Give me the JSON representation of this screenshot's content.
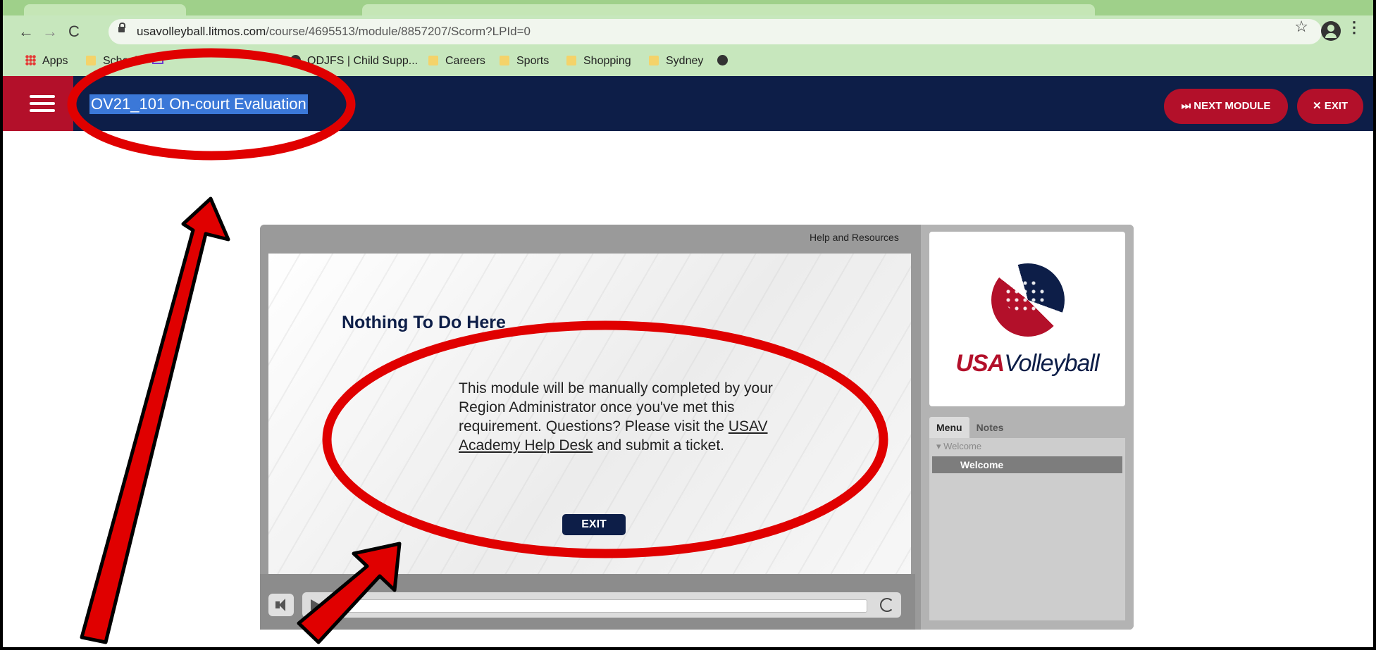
{
  "browser": {
    "url_host": "usavolleyball.litmos.com",
    "url_path": "/course/4695513/module/8857207/Scorm?LPId=0",
    "bookmarks": [
      {
        "label": "Apps",
        "icon": "apps-grid-icon"
      },
      {
        "label": "School",
        "icon": "folder-icon"
      },
      {
        "label": "ODJFS | Child Supp...",
        "icon": "globe-icon"
      },
      {
        "label": "Careers",
        "icon": "folder-icon"
      },
      {
        "label": "Sports",
        "icon": "folder-icon"
      },
      {
        "label": "Shopping",
        "icon": "folder-icon"
      },
      {
        "label": "Sydney",
        "icon": "folder-icon"
      }
    ]
  },
  "header": {
    "title": "OV21_101 On-court Evaluation",
    "next_module_label": "⏭ NEXT MODULE",
    "exit_label": "✕ EXIT"
  },
  "player": {
    "help_link": "Help and Resources",
    "slide": {
      "heading": "Nothing To Do Here",
      "body_before_link": "This module will be manually completed by your Region Administrator once you've met this requirement. Questions? Please visit the ",
      "link_text": "USAV Academy Help Desk",
      "body_after_link": " and submit a ticket.",
      "exit_button": "EXIT"
    },
    "sidebar": {
      "brand_usa": "USA",
      "brand_volleyball": "Volleyball",
      "tabs": [
        "Menu",
        "Notes"
      ],
      "menu_group": "Welcome",
      "menu_item": "Welcome"
    }
  },
  "colors": {
    "navy": "#0d1e48",
    "red": "#b3102a",
    "annotation_red": "#e00000"
  }
}
